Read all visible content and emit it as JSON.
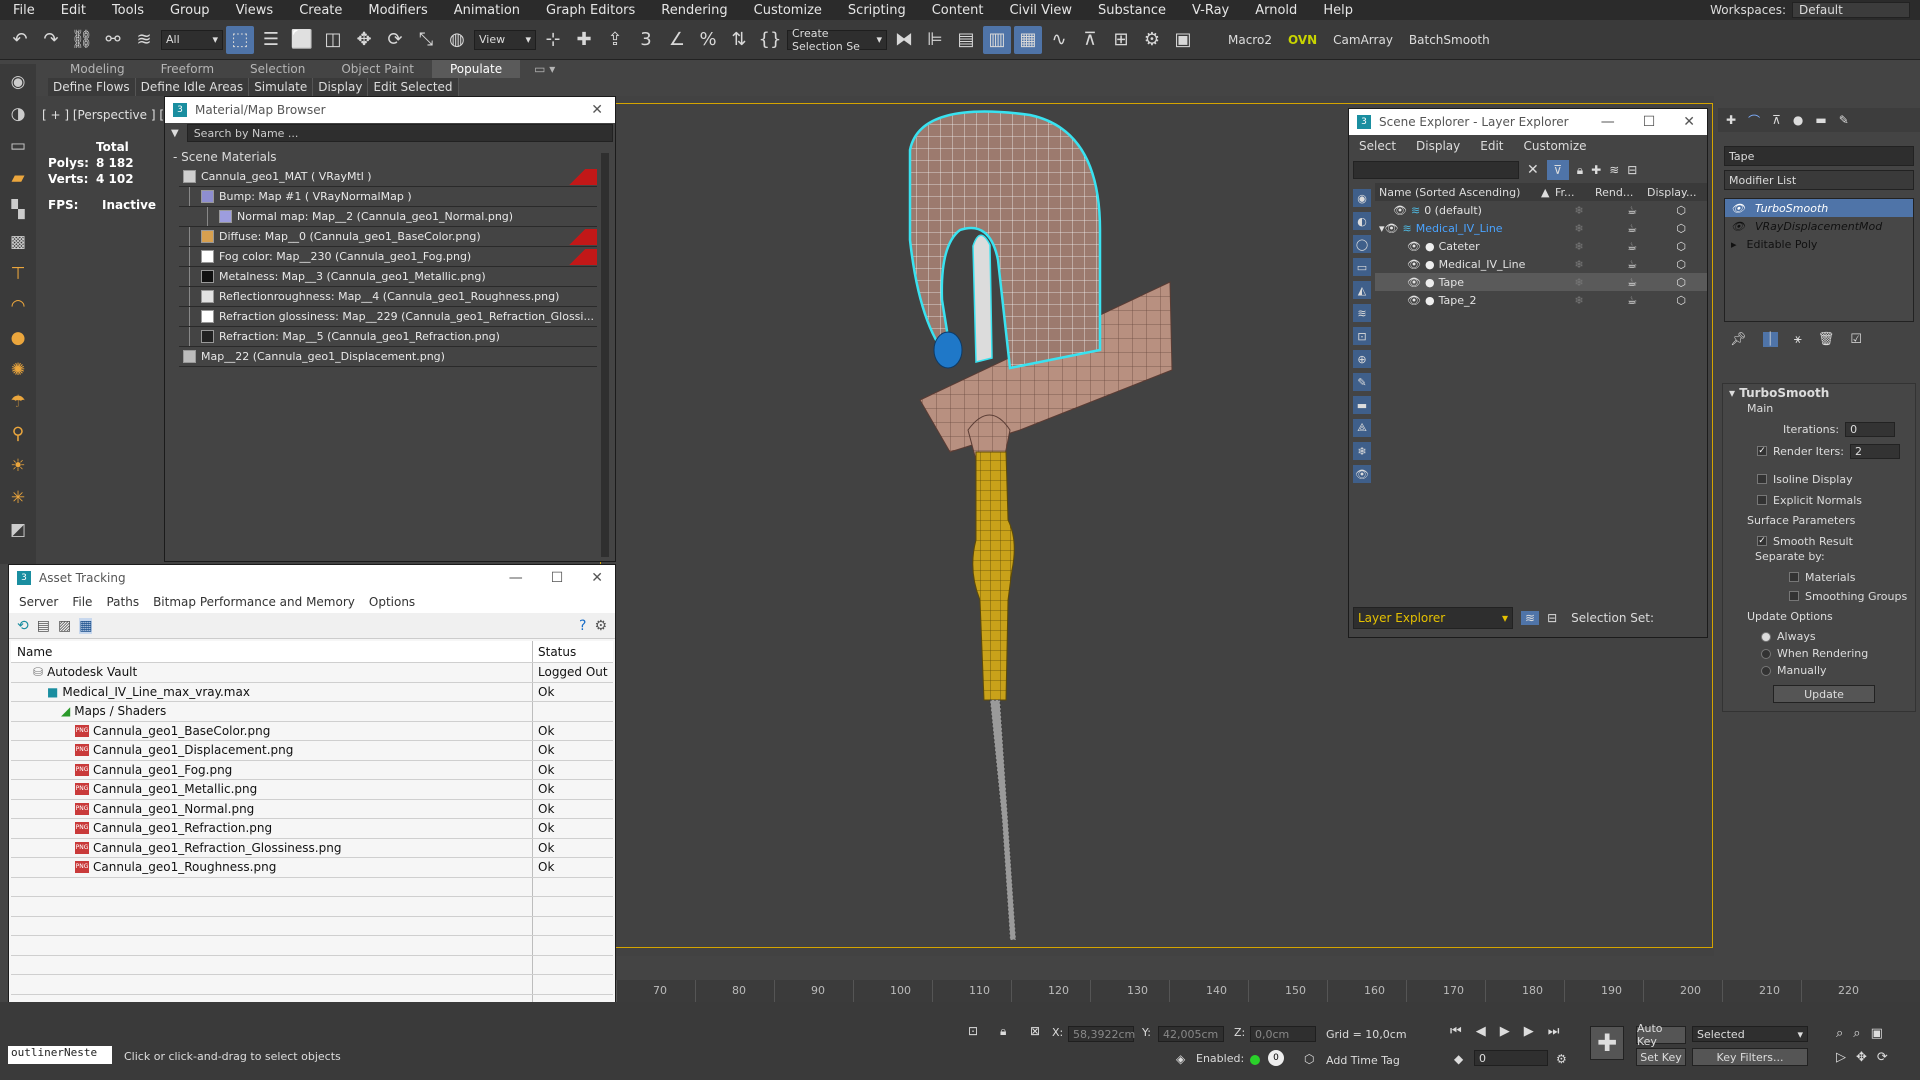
{
  "menubar": {
    "items": [
      "File",
      "Edit",
      "Tools",
      "Group",
      "Views",
      "Create",
      "Modifiers",
      "Animation",
      "Graph Editors",
      "Rendering",
      "Customize",
      "Scripting",
      "Content",
      "Civil View",
      "Substance",
      "V-Ray",
      "Arnold",
      "Help"
    ],
    "workspaces_label": "Workspaces:",
    "workspace_value": "Default"
  },
  "toolbar": {
    "filter_value": "All",
    "view_value": "View",
    "selection_set_value": "Create Selection Se",
    "macro_labels": [
      "Macro2",
      "OVN",
      "CamArray",
      "BatchSmooth"
    ]
  },
  "ribbon": {
    "tabs": [
      "Modeling",
      "Freeform",
      "Selection",
      "Object Paint",
      "Populate"
    ],
    "active_tab": 4,
    "sub_items": [
      "Define Flows",
      "Define Idle Areas",
      "Simulate",
      "Display",
      "Edit Selected"
    ]
  },
  "viewport": {
    "label": "[ + ] [Perspective ] [ Sta",
    "stats_header": "Total",
    "polys_label": "Polys:",
    "polys_value": "8 182",
    "verts_label": "Verts:",
    "verts_value": "4 102",
    "fps_label": "FPS:",
    "fps_value": "Inactive"
  },
  "material_browser": {
    "title": "Material/Map Browser",
    "search_placeholder": "Search by Name ...",
    "section": "- Scene Materials",
    "rows": [
      {
        "indent": 0,
        "text": "Cannula_geo1_MAT  ( VRayMtl )",
        "swatch": "#cfcfcf",
        "red": true
      },
      {
        "indent": 1,
        "text": "Bump: Map #1  ( VRayNormalMap )",
        "swatch": "#8e8ed0",
        "red": false
      },
      {
        "indent": 2,
        "text": "Normal map: Map__2 (Cannula_geo1_Normal.png)",
        "swatch": "#9d9dde",
        "red": false
      },
      {
        "indent": 1,
        "text": "Diffuse: Map__0 (Cannula_geo1_BaseColor.png)",
        "swatch": "#d7a050",
        "red": true
      },
      {
        "indent": 1,
        "text": "Fog color: Map__230 (Cannula_geo1_Fog.png)",
        "swatch": "#ffffff",
        "red": true
      },
      {
        "indent": 1,
        "text": "Metalness: Map__3 (Cannula_geo1_Metallic.png)",
        "swatch": "#111111",
        "red": false
      },
      {
        "indent": 1,
        "text": "Reflectionroughness: Map__4 (Cannula_geo1_Roughness.png)",
        "swatch": "#e2e2e2",
        "red": false
      },
      {
        "indent": 1,
        "text": "Refraction glossiness: Map__229 (Cannula_geo1_Refraction_Glossi...",
        "swatch": "#ffffff",
        "red": false
      },
      {
        "indent": 1,
        "text": "Refraction: Map__5 (Cannula_geo1_Refraction.png)",
        "swatch": "#222222",
        "red": false
      },
      {
        "indent": 0,
        "text": "Map__22 (Cannula_geo1_Displacement.png)",
        "swatch": "#bdbdbd",
        "red": false
      }
    ]
  },
  "asset_tracking": {
    "title": "Asset Tracking",
    "menu": [
      "Server",
      "File",
      "Paths",
      "Bitmap Performance and Memory",
      "Options"
    ],
    "col_name": "Name",
    "col_status": "Status",
    "rows": [
      {
        "indent": 0,
        "name": "Autodesk Vault",
        "status": "Logged Out",
        "icon": "vault"
      },
      {
        "indent": 1,
        "name": "Medical_IV_Line_max_vray.max",
        "status": "Ok",
        "icon": "max"
      },
      {
        "indent": 2,
        "name": "Maps / Shaders",
        "status": "",
        "icon": "folder"
      },
      {
        "indent": 3,
        "name": "Cannula_geo1_BaseColor.png",
        "status": "Ok",
        "icon": "png"
      },
      {
        "indent": 3,
        "name": "Cannula_geo1_Displacement.png",
        "status": "Ok",
        "icon": "png"
      },
      {
        "indent": 3,
        "name": "Cannula_geo1_Fog.png",
        "status": "Ok",
        "icon": "png"
      },
      {
        "indent": 3,
        "name": "Cannula_geo1_Metallic.png",
        "status": "Ok",
        "icon": "png"
      },
      {
        "indent": 3,
        "name": "Cannula_geo1_Normal.png",
        "status": "Ok",
        "icon": "png"
      },
      {
        "indent": 3,
        "name": "Cannula_geo1_Refraction.png",
        "status": "Ok",
        "icon": "png"
      },
      {
        "indent": 3,
        "name": "Cannula_geo1_Refraction_Glossiness.png",
        "status": "Ok",
        "icon": "png"
      },
      {
        "indent": 3,
        "name": "Cannula_geo1_Roughness.png",
        "status": "Ok",
        "icon": "png"
      }
    ],
    "empty_rows": 7
  },
  "scene_explorer": {
    "title": "Scene Explorer - Layer Explorer",
    "menu": [
      "Select",
      "Display",
      "Edit",
      "Customize"
    ],
    "col_name": "Name (Sorted Ascending)",
    "col_fr": "Fr...",
    "col_rend": "Rend...",
    "col_disp": "Display...",
    "rows": [
      {
        "indent": 0,
        "name": "0 (default)",
        "selected": false,
        "blue": false
      },
      {
        "indent": 0,
        "name": "Medical_IV_Line",
        "selected": false,
        "blue": true
      },
      {
        "indent": 1,
        "name": "Cateter",
        "selected": false,
        "blue": false
      },
      {
        "indent": 1,
        "name": "Medical_IV_Line",
        "selected": false,
        "blue": false
      },
      {
        "indent": 1,
        "name": "Tape",
        "selected": true,
        "blue": false
      },
      {
        "indent": 1,
        "name": "Tape_2",
        "selected": false,
        "blue": false
      }
    ],
    "footer_dropdown": "Layer Explorer",
    "selection_set_label": "Selection Set:"
  },
  "modify_panel": {
    "object_name": "Tape",
    "modifier_list_label": "Modifier List",
    "stack": [
      {
        "name": "TurboSmooth",
        "italic": true,
        "selected": true
      },
      {
        "name": "VRayDisplacementMod",
        "italic": true,
        "selected": false
      },
      {
        "name": "Editable Poly",
        "italic": false,
        "selected": false
      }
    ],
    "rollout_title": "TurboSmooth",
    "main_label": "Main",
    "iterations_label": "Iterations:",
    "iterations_value": "0",
    "render_iters_label": "Render Iters:",
    "render_iters_value": "2",
    "isoline_label": "Isoline Display",
    "explicit_normals_label": "Explicit Normals",
    "surface_params_label": "Surface Parameters",
    "smooth_result_label": "Smooth Result",
    "separate_by_label": "Separate by:",
    "materials_label": "Materials",
    "smoothing_groups_label": "Smoothing Groups",
    "update_options_label": "Update Options",
    "always_label": "Always",
    "when_rendering_label": "When Rendering",
    "manually_label": "Manually",
    "update_button": "Update"
  },
  "timeline": {
    "ticks": [
      "70",
      "80",
      "90",
      "100",
      "110",
      "120",
      "130",
      "140",
      "150",
      "160",
      "170",
      "180",
      "190",
      "200",
      "210",
      "220"
    ]
  },
  "statusbar": {
    "script_label": "outlinerNeste",
    "prompt": "Click or click-and-drag to select objects",
    "x_label": "X:",
    "x_value": "58,3922cm",
    "y_label": "Y:",
    "y_value": "42,005cm",
    "z_label": "Z:",
    "z_value": "0,0cm",
    "grid_label": "Grid = 10,0cm",
    "enabled_label": "Enabled:",
    "add_time_tag": "Add Time Tag",
    "frame_value": "0",
    "auto_key": "Auto Key",
    "set_key": "Set Key",
    "selected_value": "Selected",
    "key_filters": "Key Filters..."
  },
  "colors": {
    "accent_blue": "#4f74a8",
    "viewport_border": "#d4a400",
    "selection_cyan": "#39e2f0",
    "tape_skin": "#b89080",
    "hub_yellow": "#c9a21a"
  }
}
